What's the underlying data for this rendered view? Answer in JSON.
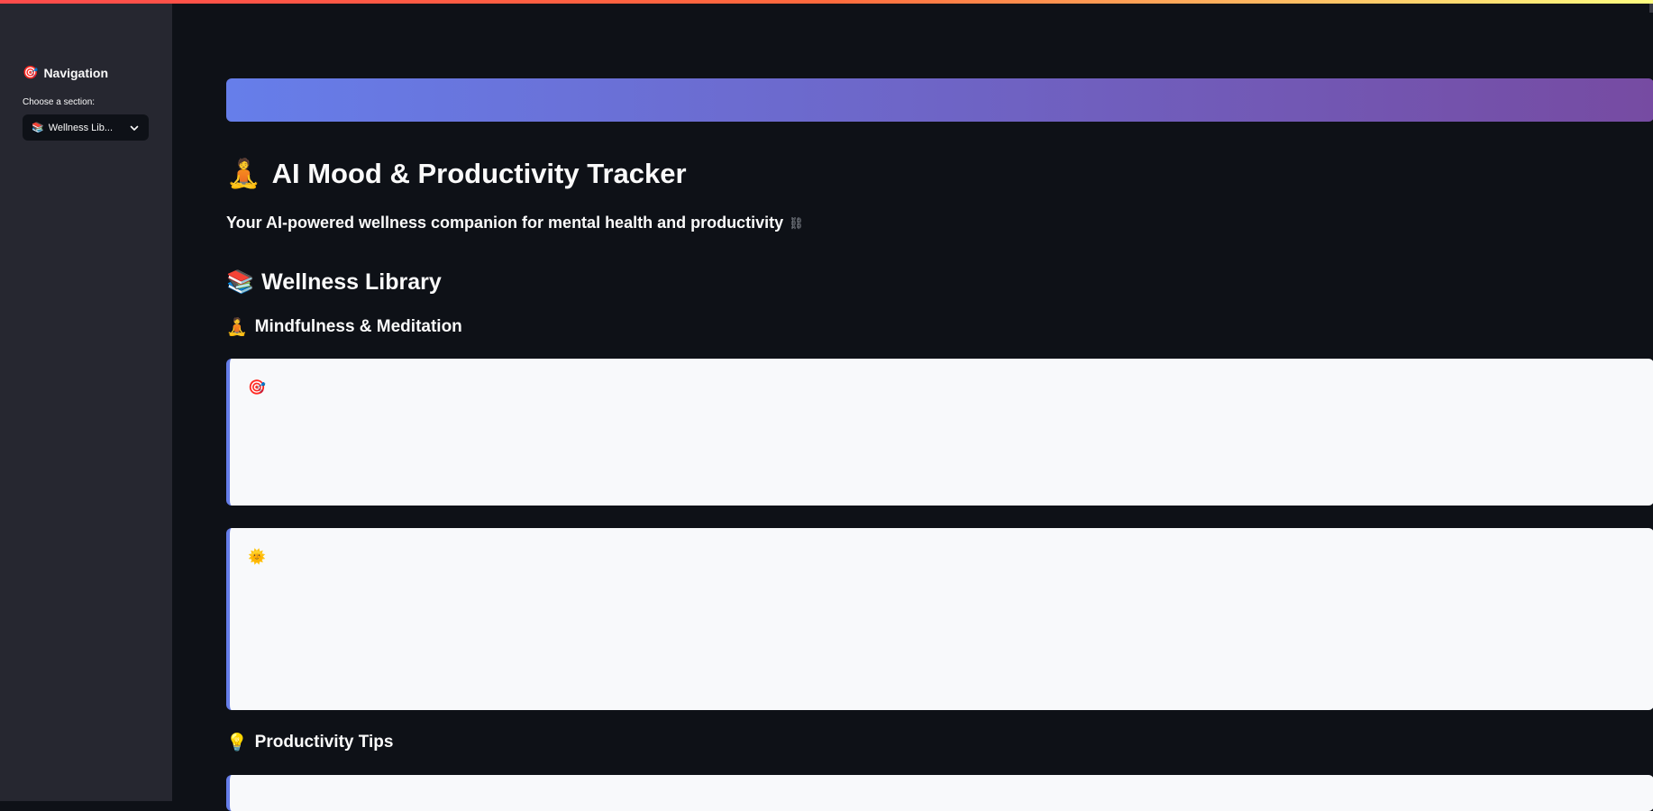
{
  "sidebar": {
    "nav_icon": "🎯",
    "nav_title": "Navigation",
    "select_label": "Choose a section:",
    "select_icon": "📚",
    "select_value": "Wellness Lib..."
  },
  "header": {
    "title_icon": "🧘",
    "title": "AI Mood & Productivity Tracker",
    "subtitle": "Your AI-powered wellness companion for mental health and productivity",
    "subtitle_link_icon": "⛓"
  },
  "library": {
    "icon": "📚",
    "title": "Wellness Library",
    "mindfulness": {
      "icon": "🧘",
      "title": "Mindfulness & Meditation",
      "cards": [
        {
          "icon": "🎯",
          "text": ""
        },
        {
          "icon": "🌞",
          "text": ""
        }
      ]
    },
    "productivity": {
      "icon": "💡",
      "title": "Productivity Tips"
    }
  },
  "colors": {
    "sidebar_bg": "#262730",
    "main_bg": "#0e1117",
    "banner_start": "#667eea",
    "banner_end": "#764ba2",
    "card_bg": "#f8f9fb",
    "card_accent": "#667eea"
  }
}
